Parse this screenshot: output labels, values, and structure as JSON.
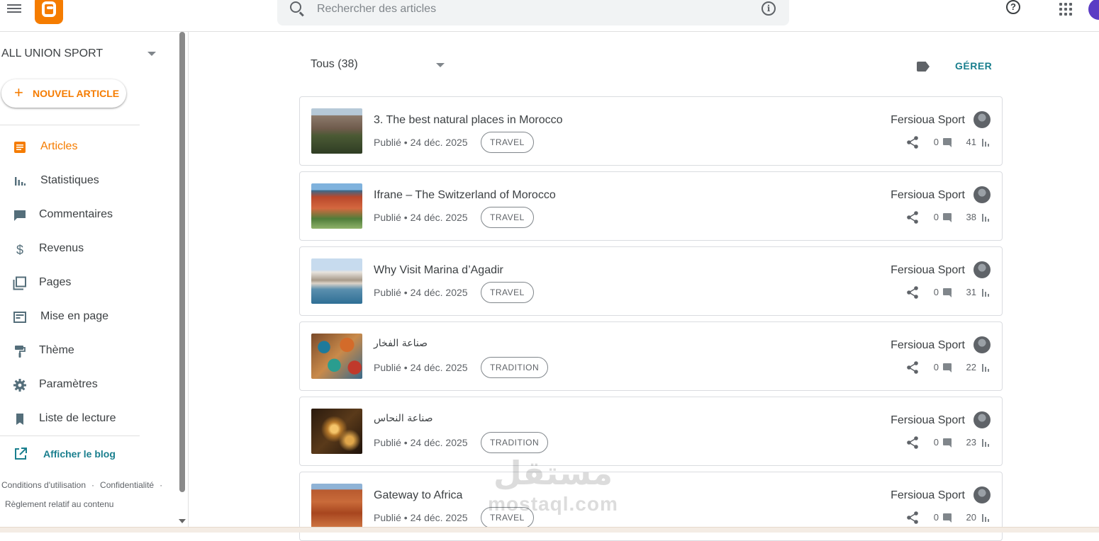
{
  "search": {
    "placeholder": "Rechercher des articles"
  },
  "sidebar": {
    "blog_name": "ALL UNION SPORT",
    "new_post_label": "NOUVEL ARTICLE",
    "items": [
      {
        "label": "Articles",
        "icon": "posts-icon",
        "active": true
      },
      {
        "label": "Statistiques",
        "icon": "stats-icon"
      },
      {
        "label": "Commentaires",
        "icon": "comment-icon"
      },
      {
        "label": "Revenus",
        "icon": "dollar-icon"
      },
      {
        "label": "Pages",
        "icon": "pages-icon"
      },
      {
        "label": "Mise en page",
        "icon": "layout-icon"
      },
      {
        "label": "Thème",
        "icon": "paint-roller-icon"
      },
      {
        "label": "Paramètres",
        "icon": "gear-icon"
      },
      {
        "label": "Liste de lecture",
        "icon": "bookmark-icon"
      }
    ],
    "view_blog_label": "Afficher le blog",
    "footer": {
      "terms": "Conditions d'utilisation",
      "privacy": "Confidentialité",
      "content_policy": "Règlement relatif au contenu",
      "sep": "·"
    }
  },
  "main": {
    "filter_label": "Tous (38)",
    "manage_label": "GÉRER",
    "status_prefix": "Publié • ",
    "posts": [
      {
        "title": "3. The best natural places in Morocco",
        "date": "24 déc. 2025",
        "tag": "TRAVEL",
        "author": "Fersioua Sport",
        "comments": "0",
        "views": "41",
        "thumb": "mountain-valley"
      },
      {
        "title": "Ifrane – The Switzerland of Morocco",
        "date": "24 déc. 2025",
        "tag": "TRAVEL",
        "author": "Fersioua Sport",
        "comments": "0",
        "views": "38",
        "thumb": "red-roofs"
      },
      {
        "title": "Why Visit Marina d’Agadir",
        "date": "24 déc. 2025",
        "tag": "TRAVEL",
        "author": "Fersioua Sport",
        "comments": "0",
        "views": "31",
        "thumb": "marina"
      },
      {
        "title": "صناعة الفخار",
        "date": "24 déc. 2025",
        "tag": "TRADITION",
        "author": "Fersioua Sport",
        "comments": "0",
        "views": "22",
        "thumb": "pottery"
      },
      {
        "title": "صناعة النحاس",
        "date": "24 déc. 2025",
        "tag": "TRADITION",
        "author": "Fersioua Sport",
        "comments": "0",
        "views": "23",
        "thumb": "copper-lamps"
      },
      {
        "title": "Gateway to Africa",
        "date": "24 déc. 2025",
        "tag": "TRAVEL",
        "author": "Fersioua Sport",
        "comments": "0",
        "views": "20",
        "thumb": "red-city"
      }
    ]
  },
  "watermark": {
    "ar": "مستقل",
    "en": "mostaql.com"
  },
  "colors": {
    "accent": "#f57c00",
    "link": "#1a7f8e"
  }
}
